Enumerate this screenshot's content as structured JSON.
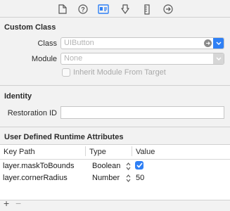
{
  "toolbar": {
    "icons": [
      "file-icon",
      "help-icon",
      "identity-inspector-icon",
      "attributes-inspector-icon",
      "size-inspector-icon",
      "connections-inspector-icon"
    ],
    "selected": "identity-inspector-icon"
  },
  "custom_class": {
    "title": "Custom Class",
    "class_label": "Class",
    "class_placeholder": "UIButton",
    "module_label": "Module",
    "module_placeholder": "None",
    "inherit_label": "Inherit Module From Target"
  },
  "identity": {
    "title": "Identity",
    "restoration_label": "Restoration ID",
    "restoration_value": ""
  },
  "runtime_attributes": {
    "title": "User Defined Runtime Attributes",
    "columns": [
      "Key Path",
      "Type",
      "Value"
    ],
    "rows": [
      {
        "key_path": "layer.maskToBounds",
        "type": "Boolean",
        "value": "",
        "checked": true
      },
      {
        "key_path": "layer.cornerRadius",
        "type": "Number",
        "value": "50",
        "checked": false
      }
    ],
    "add_label": "+",
    "remove_label": "−"
  },
  "colors": {
    "accent": "#2f80f5"
  }
}
